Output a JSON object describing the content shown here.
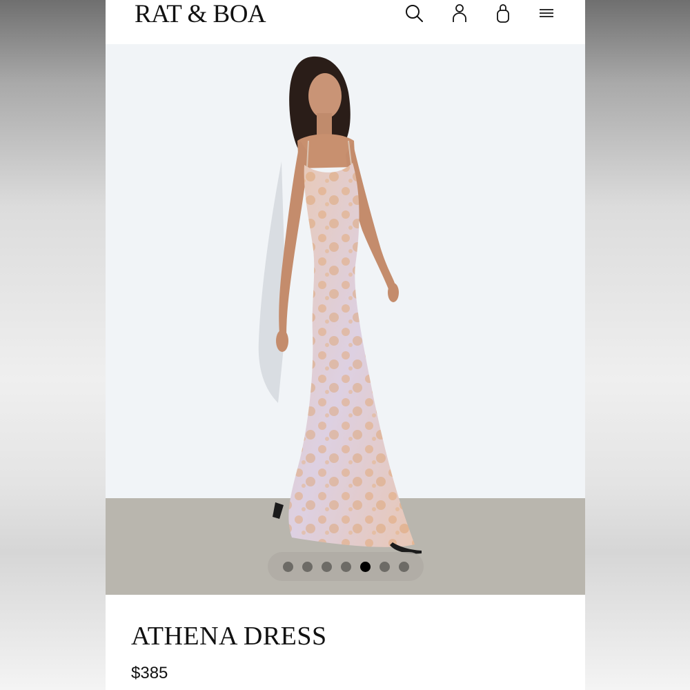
{
  "brand": {
    "logo_text": "RAT & BOA"
  },
  "header": {
    "icons": [
      "search-icon",
      "account-icon",
      "shopping-bag-icon",
      "menu-icon"
    ]
  },
  "gallery": {
    "image_subject": "product-photo",
    "total_images": 7,
    "active_index": 4
  },
  "product": {
    "name": "ATHENA DRESS",
    "price": "$385"
  },
  "colors": {
    "background": "#ffffff",
    "hero_background": "#f1f4f7",
    "floor": "#b9b6ae",
    "dot_active": "#000000",
    "dot_inactive": "#6d6b66"
  }
}
